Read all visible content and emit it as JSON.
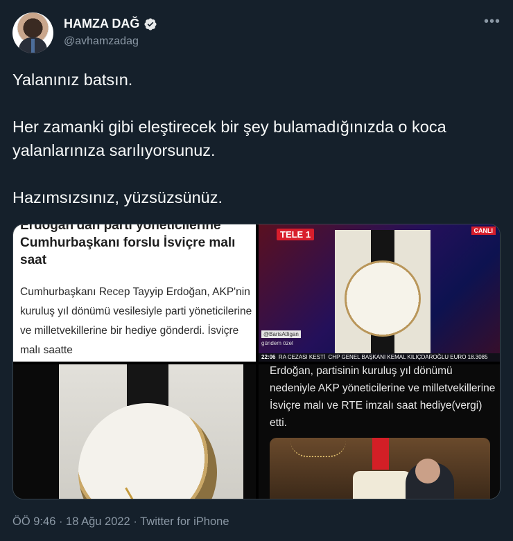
{
  "author": {
    "name": "HAMZA DAĞ",
    "handle": "@avhamzadag",
    "verified": true,
    "more_icon": "more-horizontal-icon"
  },
  "tweet": {
    "paragraphs": [
      "Yalanınız batsın.",
      "Her zamanki gibi eleştirecek bir şey bulamadığınızda o koca yalanlarınıza sarılıyorsunuz.",
      "Hazımsızsınız, yüzsüzsünüz."
    ]
  },
  "media": {
    "article": {
      "cut_headline": "Erdoğan'dan parti yöneticilerine",
      "headline": "Cumhurbaşkanı forslu İsviçre malı saat",
      "body": "Cumhurbaşkanı Recep Tayyip Erdoğan, AKP'nin kuruluş yıl dönümü vesilesiyle parti yöneticilerine ve milletvekillerine bir hediye gönderdi. İsviçre malı saatte"
    },
    "tv": {
      "channel": "TELE 1",
      "live": "CANLI",
      "source_handle": "@BarisAtligan",
      "tag": "gündem özel",
      "ticker_time": "22:06",
      "ticker_left": "RA CEZASI KESTİ",
      "ticker_right": "CHP GENEL BAŞKANI KEMAL KILIÇDAROĞLU",
      "ticker_fx": "EURO 18.3085"
    },
    "caption": "Erdoğan, partisinin kuruluş yıl dönümü nedeniyle AKP yöneticilerine ve milletvekillerine İsviçre malı ve RTE imzalı saat hediye(vergi) etti."
  },
  "footer": {
    "time": "ÖÖ 9:46",
    "sep1": " · ",
    "date": "18 Ağu 2022",
    "sep2": " · ",
    "source": "Twitter for iPhone"
  },
  "colors": {
    "background": "#15202b",
    "text": "#f7f9f9",
    "secondary": "#8b98a5",
    "verified_blue": "#d9d9d9"
  }
}
